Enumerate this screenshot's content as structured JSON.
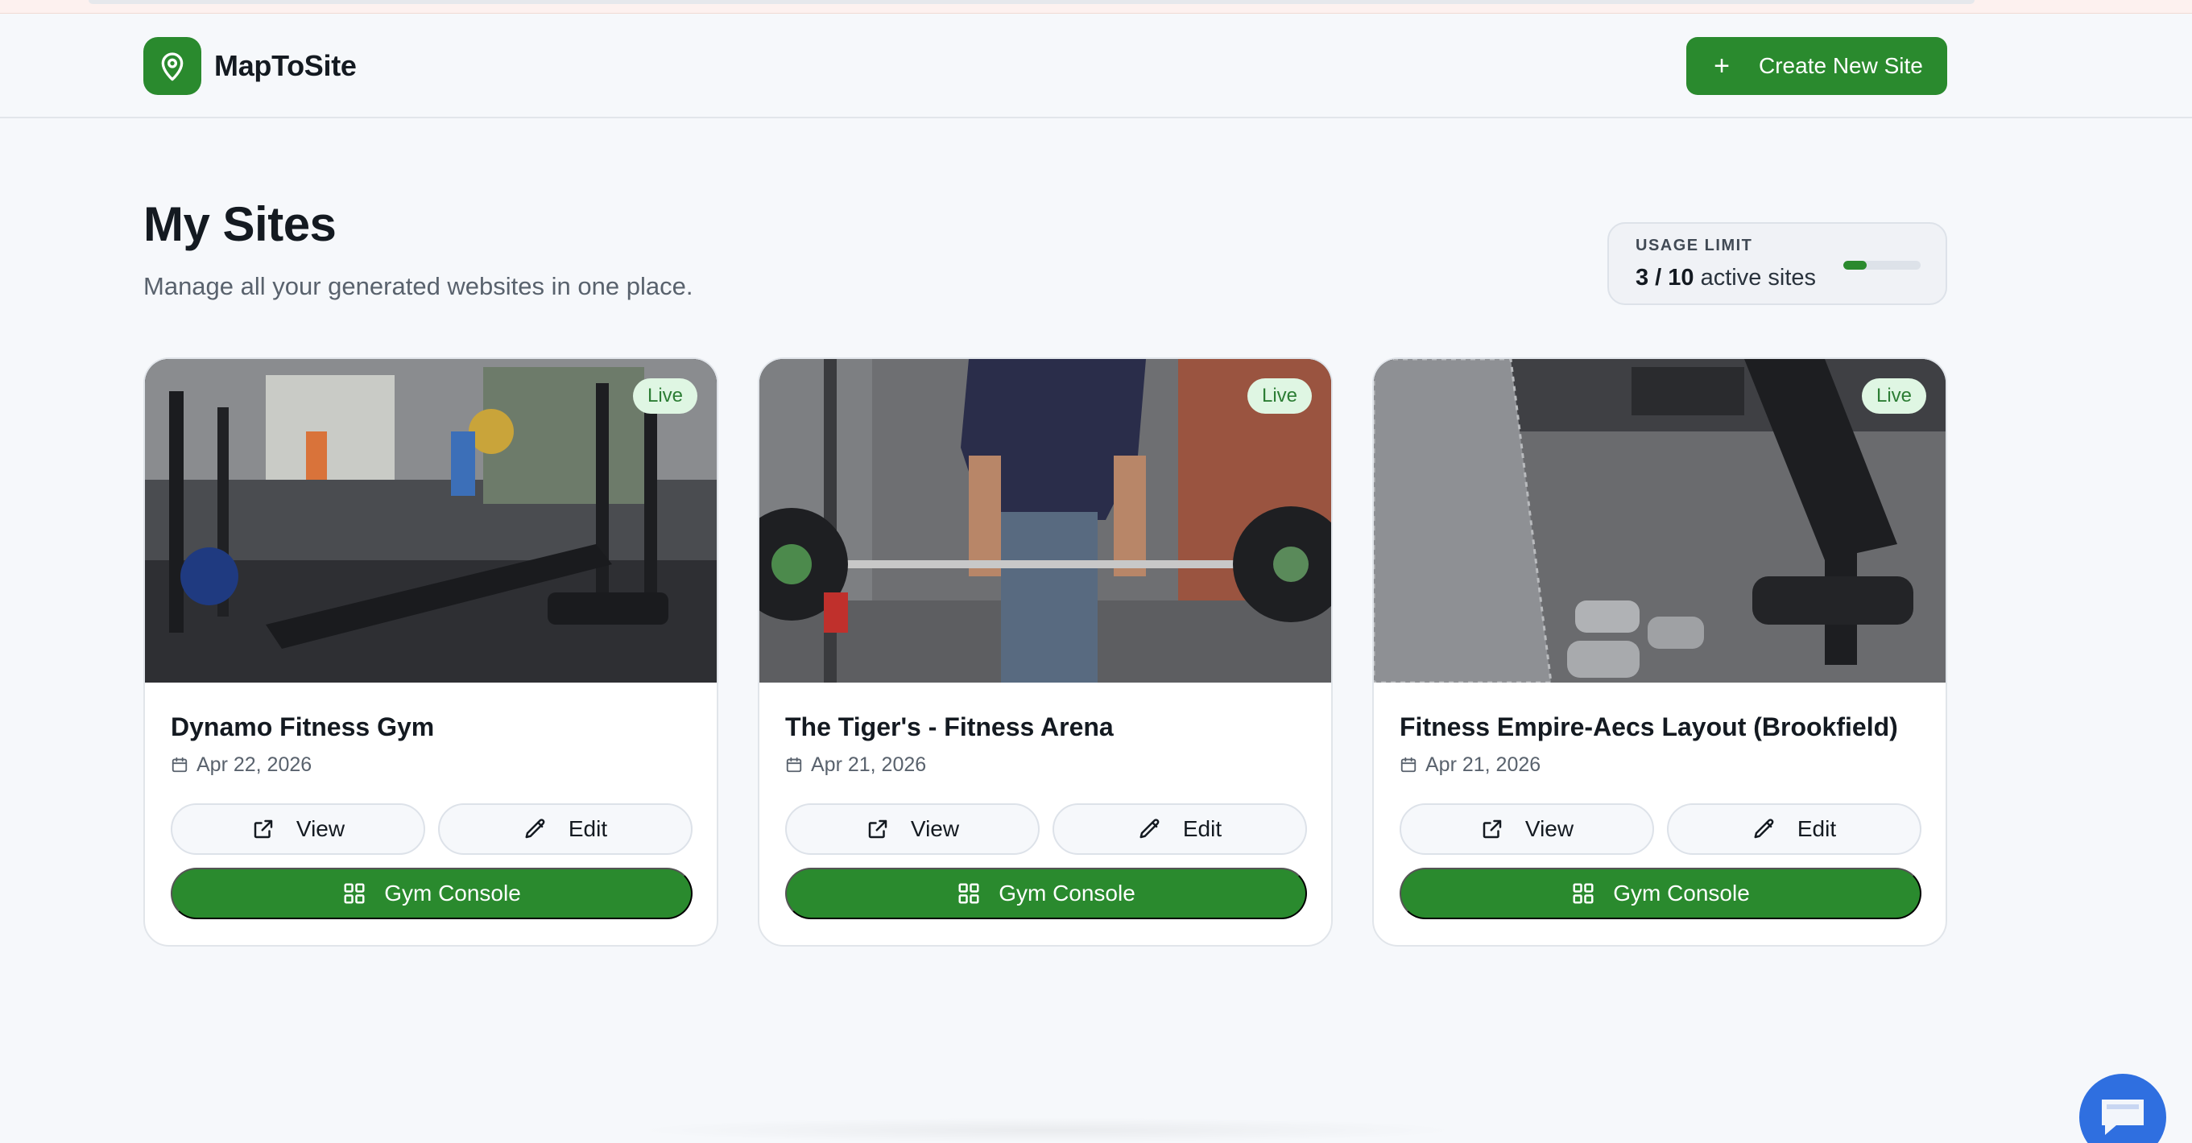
{
  "app": {
    "brand_name": "MapToSite",
    "logo_icon": "map-pin-icon",
    "accent_color": "#2a8a2e"
  },
  "header": {
    "create_button": {
      "label": "Create New Site",
      "icon": "plus-icon"
    }
  },
  "page": {
    "title": "My Sites",
    "subtitle": "Manage all your generated websites in one place."
  },
  "usage": {
    "label": "USAGE LIMIT",
    "used": "3 / 10",
    "suffix": " active sites",
    "progress_fraction": 0.3
  },
  "sites": [
    {
      "name": "Dynamo Fitness Gym",
      "date": "Apr 22, 2026",
      "status": "Live"
    },
    {
      "name": "The Tiger's - Fitness Arena",
      "date": "Apr 21, 2026",
      "status": "Live"
    },
    {
      "name": "Fitness Empire-Aecs Layout (Brookfield)",
      "date": "Apr 21, 2026",
      "status": "Live"
    }
  ],
  "card_actions": {
    "view_label": "View",
    "edit_label": "Edit",
    "console_label": "Gym Console",
    "view_icon": "external-link-icon",
    "edit_icon": "pencil-icon",
    "console_icon": "grid-icon",
    "date_icon": "calendar-icon"
  },
  "chat_widget": {
    "icon": "chat-bubble-icon"
  }
}
